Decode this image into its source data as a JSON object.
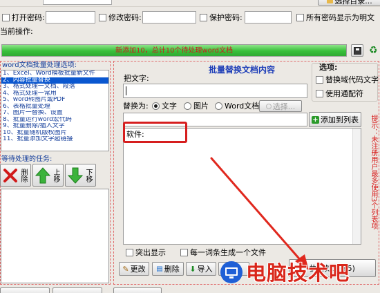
{
  "top": {
    "clipped_button": "选择目录...",
    "open_pwd_label": "打开密码:",
    "modify_pwd_label": "修改密码:",
    "protect_pwd_label": "保护密码:",
    "show_plain_label": "所有密码显示为明文",
    "current_op_label": "当前操作:"
  },
  "progress": {
    "text": "新添加10，总计10个待处理word文档",
    "fraction": 1.0
  },
  "left": {
    "options_title": "word文档批量处理选项:",
    "items": [
      "1、Excel、Word模板批量新文件",
      "2、内容批量替换",
      "3、格式处理一文档、段落",
      "4、格式处理一常用",
      "5、word转图片或PDF",
      "6、表格批量处理",
      "7、图片一替换、设置",
      "8、批量运行word宏代码",
      "9、批量删除/插入文字",
      "10、批量随机版权图片",
      "11、批量添加文字超链接"
    ],
    "selected_index": 1,
    "pending_title": "等待处理的任务:",
    "delete_label": "删除",
    "up_label": "上移",
    "down_label": "下移"
  },
  "main": {
    "title": "批量替换文档内容",
    "find_label": "把文字:",
    "replace_as_label": "替换为:",
    "radio_text": "文字",
    "radio_image": "图片",
    "radio_word": "Word文档",
    "select_button": "选择...",
    "add_list_button": "添加到列表",
    "list_entry": "软件:",
    "highlight_label": "突出显示",
    "per_word_label": "每一词条生成一个文件",
    "change_button": "更改",
    "delete_button": "删除",
    "import_button": "导入",
    "save_button_partial": "存",
    "execute_button_partial": "执行处理(F5)"
  },
  "options": {
    "title": "选项:",
    "replace_field_code": "替换域代码文字",
    "use_wildcard": "使用通配符"
  },
  "side_note": "提示：未注册用户最多使用3个列表项",
  "watermark": "电脑技术吧",
  "colors": {
    "accent_blue": "#0a57d0",
    "green_bar": "#38c03a",
    "red_text": "#d81e1e",
    "title_blue": "#1f3fb8"
  }
}
